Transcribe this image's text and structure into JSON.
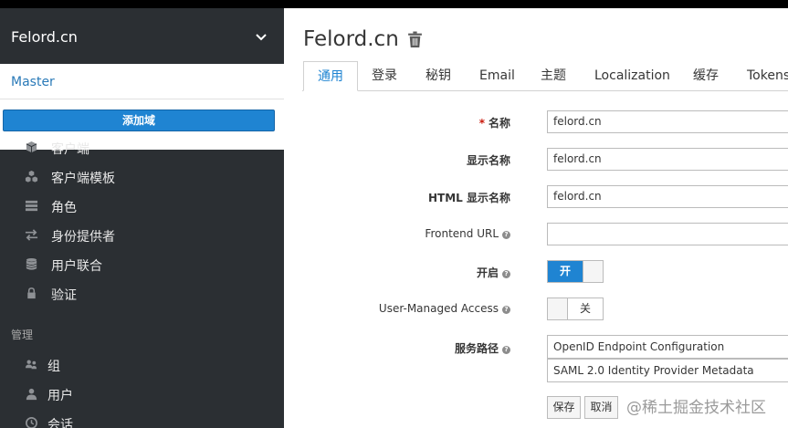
{
  "sidebar": {
    "realm_name": "Felord.cn",
    "dropdown": {
      "master": "Master",
      "add_realm": "添加域"
    },
    "configure_items": [
      {
        "label": "客户端",
        "icon": "cube-icon"
      },
      {
        "label": "客户端模板",
        "icon": "cubes-icon"
      },
      {
        "label": "角色",
        "icon": "list-icon"
      },
      {
        "label": "身份提供者",
        "icon": "exchange-icon"
      },
      {
        "label": "用户联合",
        "icon": "database-icon"
      },
      {
        "label": "验证",
        "icon": "lock-icon"
      }
    ],
    "manage_section": "管理",
    "manage_items": [
      {
        "label": "组",
        "icon": "users-icon"
      },
      {
        "label": "用户",
        "icon": "user-icon"
      },
      {
        "label": "会话",
        "icon": "clock-icon"
      }
    ]
  },
  "main": {
    "title": "Felord.cn",
    "tabs": [
      "通用",
      "登录",
      "秘钥",
      "Email",
      "主题",
      "Localization",
      "缓存",
      "Tokens"
    ],
    "active_tab": "通用",
    "form": {
      "name_label": "名称",
      "name_value": "felord.cn",
      "display_name_label": "显示名称",
      "display_name_value": "felord.cn",
      "html_display_name_label": "HTML 显示名称",
      "html_display_name_value": "felord.cn",
      "frontend_url_label": "Frontend URL",
      "frontend_url_value": "",
      "enabled_label": "开启",
      "enabled_state": "开",
      "user_managed_access_label": "User-Managed Access",
      "user_managed_access_state": "关",
      "endpoints_label": "服务路径",
      "endpoints": [
        "OpenID Endpoint Configuration",
        "SAML 2.0 Identity Provider Metadata"
      ],
      "save_label": "保存",
      "cancel_label": "取消"
    }
  },
  "watermark": "@稀土掘金技术社区",
  "colors": {
    "accent": "#1f84d2",
    "sidebar_bg": "#2b2f33",
    "required": "#c9190b"
  }
}
